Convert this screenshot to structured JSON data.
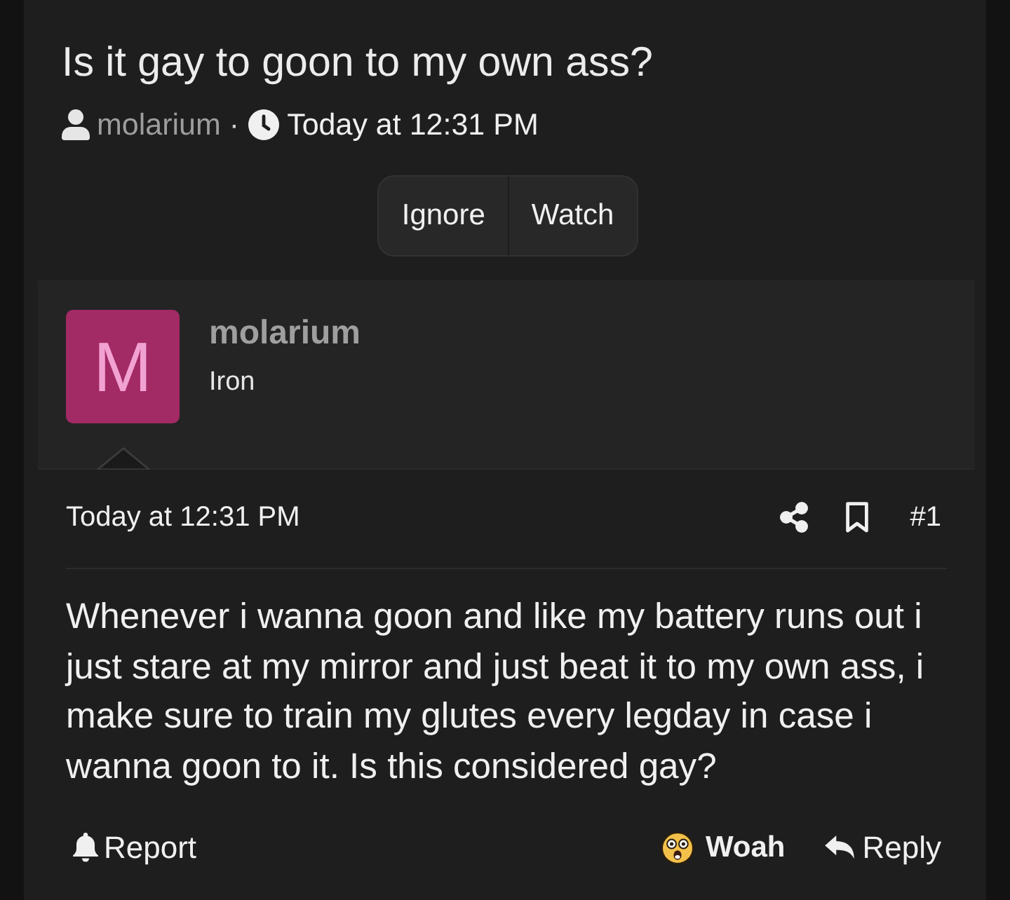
{
  "thread": {
    "title": "Is it gay to goon to my own ass?",
    "author": "molarium",
    "separator": "·",
    "date": "Today at 12:31 PM"
  },
  "thread_actions": [
    "Ignore",
    "Watch"
  ],
  "post": {
    "author": {
      "initial": "M",
      "name": "molarium",
      "rank": "Iron"
    },
    "date": "Today at 12:31 PM",
    "number": "#1",
    "body": "Whenever i wanna goon and like my battery runs out i just stare at my mirror and just beat it to my own ass, i make sure to train my glutes every legday in case i wanna goon to it. Is this considered gay?",
    "footer": {
      "left": [
        {
          "kind": "report",
          "label": "Report"
        }
      ],
      "right": [
        {
          "kind": "reaction",
          "label": "Woah"
        },
        {
          "kind": "reply",
          "label": "Reply"
        }
      ]
    }
  }
}
